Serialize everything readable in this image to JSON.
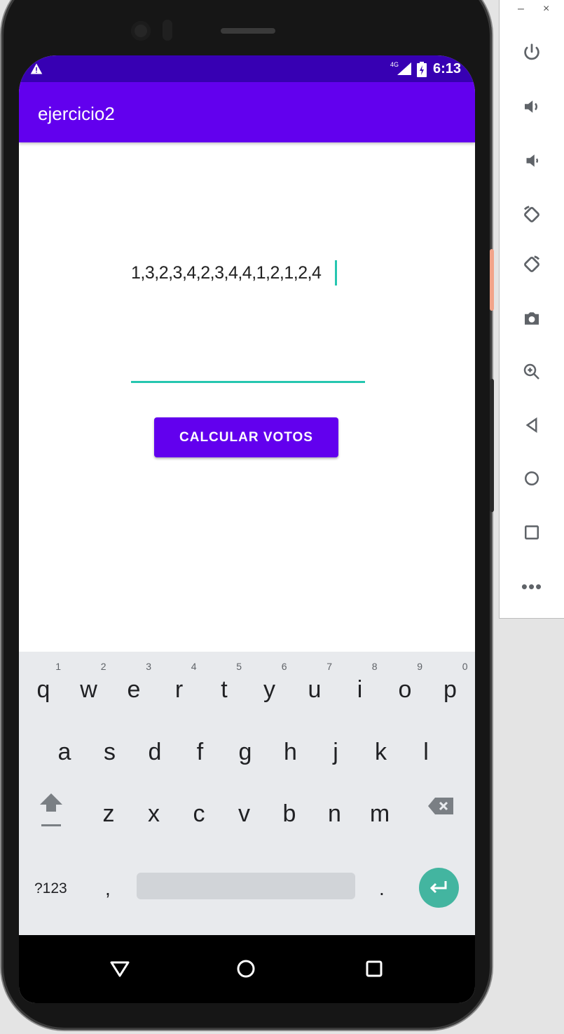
{
  "emulator": {
    "window_controls": [
      "–",
      "×"
    ],
    "tools": [
      "power-icon",
      "volume-up-icon",
      "volume-down-icon",
      "rotate-left-icon",
      "rotate-right-icon",
      "camera-icon",
      "zoom-icon",
      "back-icon",
      "home-icon",
      "overview-icon",
      "more-icon"
    ],
    "more_label": "•••"
  },
  "status_bar": {
    "network": "4G",
    "time": "6:13"
  },
  "app_bar": {
    "title": "ejercicio2"
  },
  "main": {
    "votes_text": "1,3,2,3,4,2,3,4,4,1,2,1,2,4",
    "input_value": "",
    "button_label": "CALCULAR VOTOS"
  },
  "keyboard": {
    "row1": [
      {
        "key": "q",
        "hint": "1"
      },
      {
        "key": "w",
        "hint": "2"
      },
      {
        "key": "e",
        "hint": "3"
      },
      {
        "key": "r",
        "hint": "4"
      },
      {
        "key": "t",
        "hint": "5"
      },
      {
        "key": "y",
        "hint": "6"
      },
      {
        "key": "u",
        "hint": "7"
      },
      {
        "key": "i",
        "hint": "8"
      },
      {
        "key": "o",
        "hint": "9"
      },
      {
        "key": "p",
        "hint": "0"
      }
    ],
    "row2": [
      "a",
      "s",
      "d",
      "f",
      "g",
      "h",
      "j",
      "k",
      "l"
    ],
    "row3": [
      "z",
      "x",
      "c",
      "v",
      "b",
      "n",
      "m"
    ],
    "sym_label": "?123",
    "comma": ",",
    "period": "."
  },
  "colors": {
    "primary": "#6200ee",
    "primary_dark": "#3700b3",
    "accent": "#26c6b0",
    "enter": "#43b5a0"
  }
}
